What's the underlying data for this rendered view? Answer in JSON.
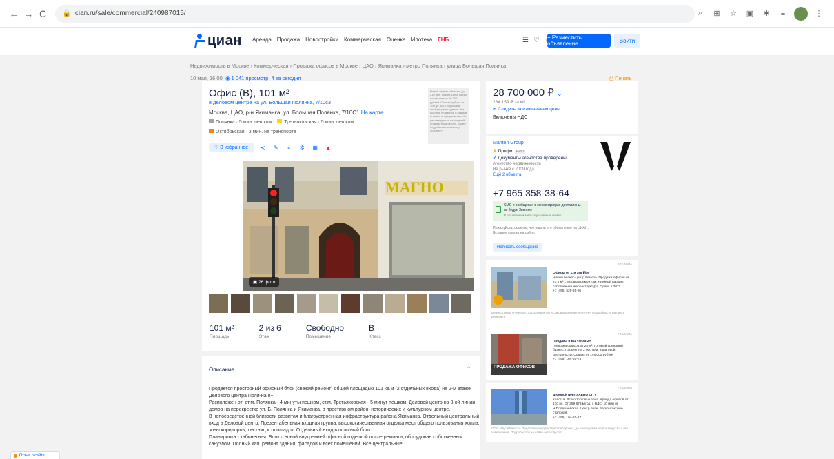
{
  "browser": {
    "url": "cian.ru/sale/commercial/240987015/"
  },
  "header": {
    "logo": "циан",
    "nav": [
      "Аренда",
      "Продажа",
      "Новостройки",
      "Коммерческая",
      "Оценка",
      "Ипотека"
    ],
    "nav_new": "ГНБ",
    "place_button": "+ Разместить объявление",
    "login_button": "Войти"
  },
  "breadcrumb": "Недвижимость в Москве › Коммерческая › Продажа офисов в Москве › ЦАО › Якиманка › метро Полянка › улица Большая Полянка",
  "meta": {
    "date": "10 мая, 16:00",
    "views": "1 041 просмотр, 4 за сегодня",
    "print": "Печать"
  },
  "listing": {
    "title": "Офис (B), 101 м²",
    "subtitle": "в деловом центре на ул. Большая Полянка, 7/10с3",
    "address": "Москва, ЦАО, р-н Якиманка, ул. Большая Полянка, 7/10С1",
    "map_link": "На карте",
    "metro": [
      {
        "name": "Полянка",
        "time": "5 мин. пешком",
        "color": "#a1a2a3"
      },
      {
        "name": "Третьяковская",
        "time": "5 мин. пешком",
        "color": "#ffd702"
      },
      {
        "name": "Октябрьская",
        "time": "3 мин. на транспорте",
        "color": "#ff8103"
      }
    ],
    "note": "Новый сервис объектов до 210 мин. рядом. Цена офиса составляет от 50 000 рублей. Схема подбора от 100 до 301. Подробная инструкция по сделке. Все условия по данной и каждой стоимости предложения. Не рекомендуется на средний стоимостный ресурс. Более подробно по телефону «Бизнес».",
    "favorite": "В избранное",
    "photo_count": "26 фото",
    "facts": [
      {
        "value": "101 м²",
        "label": "Площадь"
      },
      {
        "value": "2 из 6",
        "label": "Этаж"
      },
      {
        "value": "Свободно",
        "label": "Помещение"
      },
      {
        "value": "B",
        "label": "Класс"
      }
    ]
  },
  "description": {
    "heading": "Описание",
    "paragraphs": [
      "Продается просторный офисный блок (свежий ремонт) общей площадью 101 кв.м (2 отдельных входа) на 2-м этаже Делового центра Поля-на 8+.",
      "Расположен от: ст.м. Полянка - 4 минуты пешком, ст.м. Третьяковская - 5 минут пешком. Деловой центр на 3-ой линии домов на перекрестке ул. Б. Полянка и Якиманка, в престижном район, исторических и культурном центре.",
      "В непосредственной близости развитая и благоустроенная инфраструктура района Якиманка. Отдельный центральный вход в Деловой центр. Презентабельная входная группа, высококачественная отделка мест общего пользования холла, зоны коридоров, лестниц и площадок. Отдельный вход в офисный блок.",
      "Планировка - кабинетная. Блок с новой внутренней офисной отделкой после ремонта, оборудован собственным санузлом. Полный кап. ремонт здания, фасадов и всех помещений. Все центральные"
    ]
  },
  "price": {
    "value": "28 700 000 ₽",
    "per_meter": "284 159 ₽ за м²",
    "watch": "Следить за изменением цены",
    "vat": "Включены НДС"
  },
  "agent": {
    "name": "Manton Group",
    "pro": "Профи",
    "pro_badge": "PRO",
    "verified": "Документы агентства проверены",
    "lines": [
      "Агентство недвижимости",
      "На рынке с 2009 года",
      "Ещё 2 объекта"
    ],
    "phone": "+7 965 358-38-64",
    "sms_title": "СМС и сообщения в мессенджерах доставлены не будут. Звоните",
    "sms_sub": "В объявлении Нельзя указанный номер",
    "hint": "Пожалуйста, скажите, что нашли это объявление на ЦИАН. Вставьте ссылку на сайте.",
    "message_button": "Написать сообщение"
  },
  "ads": [
    {
      "label": "РЕКЛАМА",
      "title": "Офисы от 119 788 ₽/м²",
      "text": "Новый бизнес-центр Ремеза. Продажа офисов от 27,2 м² с готовым ремонтом. Удобный паркинг, собственная инфраструктура. Сдача в 2021 г.",
      "phone": "+7 (495) 525-35-95",
      "foot": "Бизнес-центр «Ремеза». Застройщик АО «Специализиров ОРТРАН». Подробности на сайте ремеза.ru"
    },
    {
      "label": "РЕКЛАМА",
      "title": "Продажа в БЦ «Octa-2»",
      "text": "Продажа офисов от 25 м². Готовый арендный бизнес. Паркинг на 2 000 м/м, в шаговой доступности. Офисы от 145 000 руб./м²",
      "phone": "+7 (495) 104-60-73",
      "img_text": "ПРОДАЖА ОФИСОВ"
    },
    {
      "label": "РЕКЛАМА",
      "title": "Деловой центр AERO CITY",
      "text": "Класс А. Всего торговых зона. Аренда офисов от 170 м². От 389 873 ₽/год, с НДС. 10 мин от м.Полежаевская. Центр Бизн. Бесконтактные столовая.",
      "phone": "+7 (495) 104-20-17",
      "foot": "ООО «РусаИнвест». Предложения действуют бессрочно, до распродажи и производство с его завершения. Подробности на сайте aero-city.com"
    }
  ],
  "feedback": "Отзыв о сайте",
  "colors": {
    "accent": "#0468ff",
    "text": "#152242",
    "background": "#f2f2f2",
    "sms_green": "#2e9e3e"
  }
}
